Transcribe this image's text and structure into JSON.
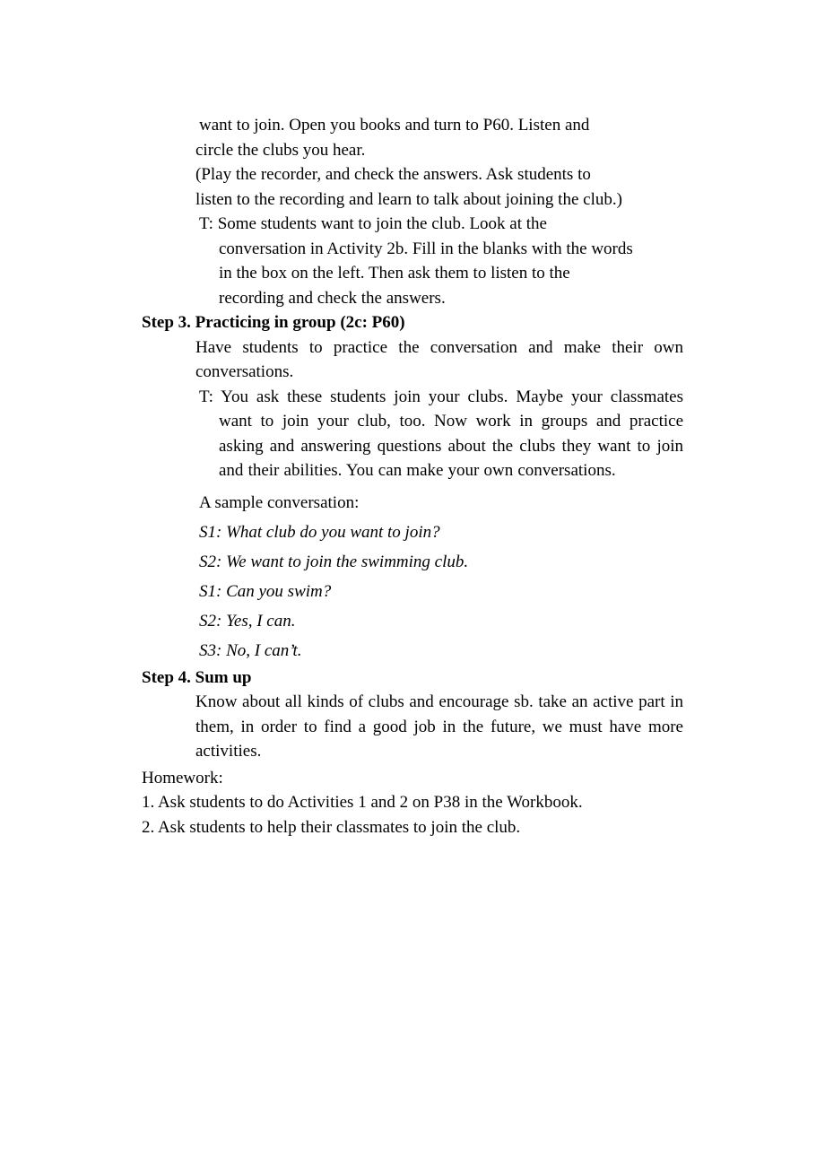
{
  "document": {
    "continued_paragraph": {
      "line_1": "want to join. Open you books and turn to P60. Listen and",
      "line_2": "circle the clubs you hear."
    },
    "stage_direction": {
      "line_1": "(Play the recorder, and check the answers. Ask students to",
      "line_2": "listen to the recording and learn to talk about joining the club.)"
    },
    "teacher_instruction_1": {
      "line_1": "T: Some students want to join the club. Look at the",
      "line_2": "conversation in Activity 2b. Fill in the blanks with the words",
      "line_3": "in the box on the left. Then ask them to listen to the",
      "line_4": "recording and check the answers."
    },
    "step_3": {
      "heading": "Step 3. Practicing in group (2c: P60)",
      "body": "Have students to practice the conversation and make their own conversations.",
      "teacher_speech": "T: You ask these students join your clubs. Maybe your classmates want to join your club, too. Now work in groups and practice asking and answering questions about the clubs they want to join and their abilities. You can make your own conversations."
    },
    "sample_conversation": {
      "intro": "A sample conversation:",
      "lines": [
        "S1: What club do you want to join?",
        "S2: We want to join the swimming club.",
        "S1: Can you swim?",
        "S2: Yes, I can.",
        "S3: No, I can’t."
      ]
    },
    "step_4": {
      "heading": "Step 4. Sum up",
      "body": "Know about all kinds of clubs and encourage sb. take an active part in them, in order to find a good job in the future, we must have more activities."
    },
    "homework": {
      "heading": "Homework:",
      "items": [
        "1. Ask students to do Activities 1 and 2 on P38 in the Workbook.",
        "2. Ask students to help their classmates to join the club."
      ]
    }
  }
}
